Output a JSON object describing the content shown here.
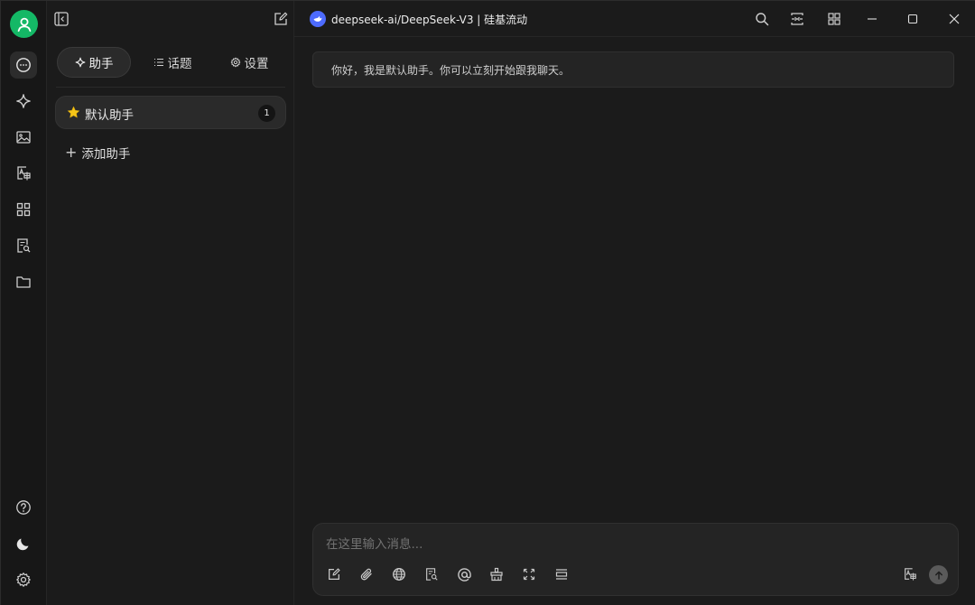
{
  "sidebar": {
    "tabs": [
      {
        "label": "助手",
        "icon": "sparkle-icon"
      },
      {
        "label": "话题",
        "icon": "list-icon"
      },
      {
        "label": "设置",
        "icon": "gear-icon"
      }
    ],
    "assistants": [
      {
        "label": "默认助手",
        "count": "1",
        "icon": "star-emoji"
      }
    ],
    "add_label": "添加助手"
  },
  "topbar": {
    "model_label": "deepseek-ai/DeepSeek-V3 | 硅基流动"
  },
  "chat": {
    "greeting": "你好，我是默认助手。你可以立刻开始跟我聊天。"
  },
  "composer": {
    "placeholder": "在这里输入消息..."
  },
  "colors": {
    "avatar": "#14b866",
    "background": "#1b1b1b",
    "rail": "#171717",
    "panel": "#242424",
    "model_brand": "#4d6bfe",
    "star": "#f5c518"
  }
}
